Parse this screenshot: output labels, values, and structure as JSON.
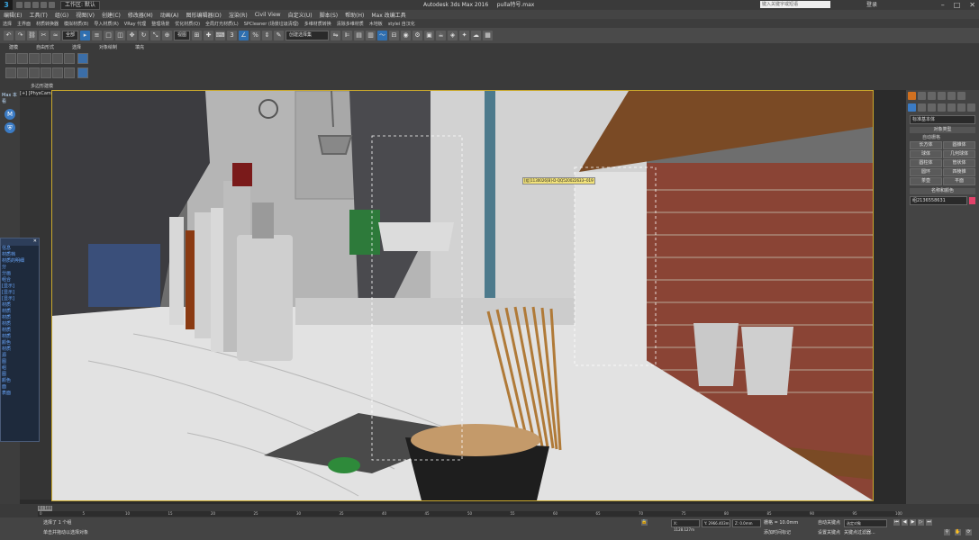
{
  "titlebar": {
    "workspace": "工作区: 默认",
    "app_title": "Autodesk 3ds Max 2016",
    "filename": "pulla特号.max",
    "search_placeholder": "键入关键字或短语",
    "user": "登录"
  },
  "menu": [
    "编辑(E)",
    "工具(T)",
    "组(G)",
    "视图(V)",
    "创建(C)",
    "修改器(M)",
    "动画(A)",
    "图形编辑器(D)",
    "渲染(R)",
    "Civil View",
    "自定义(U)",
    "脚本(S)",
    "帮助(H)",
    "Max 改编工具"
  ],
  "menu2": [
    "选择",
    "主界面",
    "材质转换器",
    "模拟材质(B)",
    "导入材质(R)",
    "VRay 代理",
    "整理场景",
    "优化材质(Q)",
    "全局灯光材质(L)",
    "SPCleaner (场景垃圾清理)",
    "多维材质转换",
    "清除多维材质",
    "木地板",
    "stylei 自汉化"
  ],
  "toolbar": {
    "filter": "全部",
    "view": "视图",
    "named_sel": "创建选择集"
  },
  "ribbon_tabs": [
    "建模",
    "自由形式",
    "选择",
    "对象绘制",
    "填充"
  ],
  "ribbon_label": "多边形建模",
  "viewport": {
    "label": "[+] [PhysCamera004] [明暗处理]",
    "tooltip": "[组]1130026[B]-D-QQ520022633--019"
  },
  "left": {
    "label": "Max 本看"
  },
  "float_panel": {
    "items": [
      "信息",
      "材质档",
      "材质的明细",
      "分",
      "分画",
      "组合",
      "[显示]",
      "[显示]",
      "[显示]",
      "材质",
      "材质",
      "材质",
      "材质",
      "材质",
      "材质",
      "颜色",
      "材质",
      "源",
      "图",
      "组",
      "图",
      "颜色",
      "面",
      "表面"
    ]
  },
  "cmd": {
    "dropdown": "标准基本体",
    "section_type": "对象类型",
    "autogrid": "自动栅格",
    "buttons": [
      "长方体",
      "圆锥体",
      "球体",
      "几何球体",
      "圆柱体",
      "管状体",
      "圆环",
      "四棱锥",
      "茶壶",
      "平面"
    ],
    "section_name": "名称和颜色",
    "name": "组2136558631",
    "swatch_color": "#e2426a"
  },
  "timeline": {
    "slider": "0 / 100",
    "ticks": [
      "0",
      "5",
      "10",
      "15",
      "20",
      "25",
      "30",
      "35",
      "40",
      "45",
      "50",
      "55",
      "60",
      "65",
      "70",
      "75",
      "80",
      "85",
      "90",
      "95",
      "100"
    ]
  },
  "status": {
    "selected": "选择了 1 个组",
    "prompt": "单击并拖动以选择对象",
    "x": "X: 1128.127m",
    "y": "Y: 2966.403m",
    "z": "Z: 0.0mm",
    "grid": "栅格 = 10.0mm",
    "autokey": "自动关键点",
    "setkey": "设置关键点",
    "selected_obj": "选定对象",
    "key_filters": "关键点过滤器...",
    "time_tag": "添加时间标记"
  }
}
